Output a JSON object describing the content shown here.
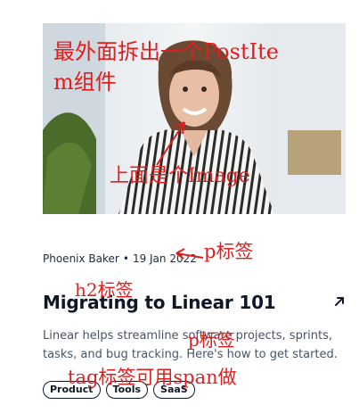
{
  "post": {
    "image_alt": "portrait photo of smiling woman",
    "author": "Phoenix Baker",
    "separator": "•",
    "date": "19 Jan 2022",
    "title": "Migrating to Linear 101",
    "excerpt": "Linear helps streamline software projects, sprints, tasks, and bug tracking. Here's how to get started.",
    "tags": [
      "Product",
      "Tools",
      "SaaS"
    ]
  },
  "annotations": {
    "outer_line1": "最外面拆出一个PostIte",
    "outer_line2": "m组件",
    "image_note": "上面是个Image",
    "p_note_1": "p标签",
    "h2_note": "h2标签",
    "p_note_2": "p标签",
    "tag_note": "tag标签可用span做"
  },
  "colors": {
    "annotation": "#e11d1d",
    "title": "#101828",
    "excerpt": "#475467"
  },
  "icons": {
    "arrow": "arrow-up-right-icon"
  }
}
